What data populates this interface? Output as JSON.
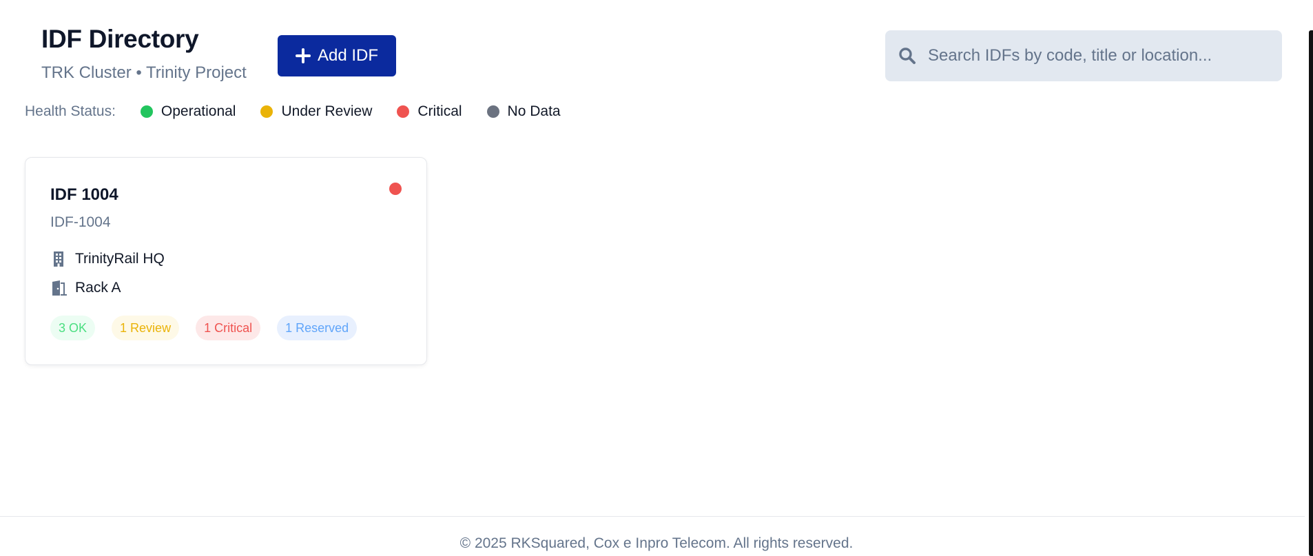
{
  "header": {
    "title": "IDF Directory",
    "subtitle": "TRK Cluster • Trinity Project",
    "add_button_label": "Add IDF",
    "add_button_icon": "plus-icon"
  },
  "search": {
    "placeholder": "Search IDFs by code, title or location...",
    "value": "",
    "icon": "search-icon"
  },
  "legend": {
    "label": "Health Status:",
    "items": [
      {
        "label": "Operational",
        "color": "#22c55e"
      },
      {
        "label": "Under Review",
        "color": "#eab308"
      },
      {
        "label": "Critical",
        "color": "#ef5350"
      },
      {
        "label": "No Data",
        "color": "#6b7280"
      }
    ]
  },
  "cards": [
    {
      "title": "IDF 1004",
      "code": "IDF-1004",
      "status_color": "#ef5350",
      "site": "TrinityRail HQ",
      "site_icon": "building-icon",
      "rack": "Rack A",
      "rack_icon": "door-icon",
      "badges": [
        {
          "label": "3 OK",
          "bg": "#ecfdf3",
          "fg": "#4ade80"
        },
        {
          "label": "1 Review",
          "bg": "#fef9e7",
          "fg": "#eab308"
        },
        {
          "label": "1 Critical",
          "bg": "#fde8e8",
          "fg": "#ef5350"
        },
        {
          "label": "1 Reserved",
          "bg": "#e8f0fe",
          "fg": "#60a5fa"
        }
      ]
    }
  ],
  "footer": {
    "text": "© 2025 RKSquared, Cox e Inpro Telecom. All rights reserved."
  }
}
